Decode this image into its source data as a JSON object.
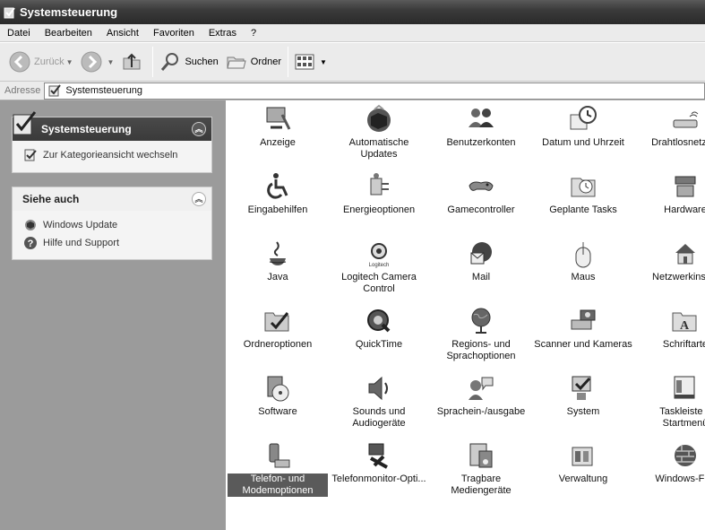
{
  "window": {
    "title": "Systemsteuerung"
  },
  "menu": [
    "Datei",
    "Bearbeiten",
    "Ansicht",
    "Favoriten",
    "Extras",
    "?"
  ],
  "toolbar": {
    "back": "Zurück",
    "search": "Suchen",
    "folders": "Ordner"
  },
  "address": {
    "label": "Adresse",
    "value": "Systemsteuerung"
  },
  "sidebar": {
    "panel_main": {
      "title": "Systemsteuerung",
      "items": [
        "Zur Kategorieansicht wechseln"
      ]
    },
    "panel_see_also": {
      "title": "Siehe auch",
      "items": [
        "Windows Update",
        "Hilfe und Support"
      ]
    }
  },
  "items": [
    [
      "Anzeige",
      "Automatische Updates",
      "Benutzerkonten",
      "Datum und Uhrzeit",
      "Drahtlosnetzwe"
    ],
    [
      "Eingabehilfen",
      "Energieoptionen",
      "Gamecontroller",
      "Geplante Tasks",
      "Hardware"
    ],
    [
      "Java",
      "Logitech Camera Control",
      "Mail",
      "Maus",
      "Netzwerkinstall"
    ],
    [
      "Ordneroptionen",
      "QuickTime",
      "Regions- und Sprachoptionen",
      "Scanner und Kameras",
      "Schriftarte"
    ],
    [
      "Software",
      "Sounds und Audiogeräte",
      "Sprachein-/ausgabe",
      "System",
      "Taskleiste u Startmenü"
    ],
    [
      "Telefon- und Modemoptionen",
      "Telefonmonitor-Opti...",
      "Tragbare Mediengeräte",
      "Verwaltung",
      "Windows-Fire"
    ]
  ],
  "selected_item": "Telefon- und Modemoptionen"
}
